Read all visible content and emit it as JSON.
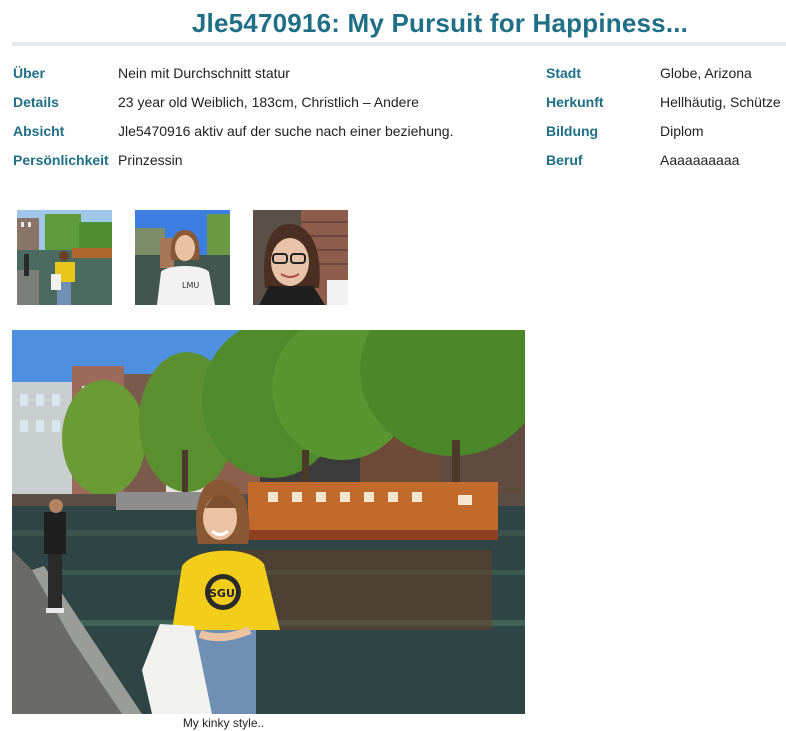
{
  "profile": {
    "title": "Jle5470916: My Pursuit for Happiness..."
  },
  "details_left": [
    {
      "label": "Über",
      "value": "Nein mit Durchschnitt statur"
    },
    {
      "label": "Details",
      "value": "23 year old Weiblich, 183cm, Christlich – Andere"
    },
    {
      "label": "Absicht",
      "value": "Jle5470916 aktiv auf der suche nach einer beziehung."
    },
    {
      "label": "Persönlichkeit",
      "value": "Prinzessin"
    }
  ],
  "details_right": [
    {
      "label": "Stadt",
      "value": "Globe, Arizona"
    },
    {
      "label": "Herkunft",
      "value": "Hellhäutig, Schütze"
    },
    {
      "label": "Bildung",
      "value": "Diplom"
    },
    {
      "label": "Beruf",
      "value": "Aaaaaaaaaa"
    }
  ],
  "gallery": {
    "thumbnails": [
      "thumbnail-canal-photo",
      "thumbnail-sweatshirt-photo",
      "thumbnail-glasses-photo"
    ],
    "main_caption": "My kinky style.."
  },
  "colors": {
    "accent": "#1f6f86",
    "rule": "#e4e9f3"
  }
}
